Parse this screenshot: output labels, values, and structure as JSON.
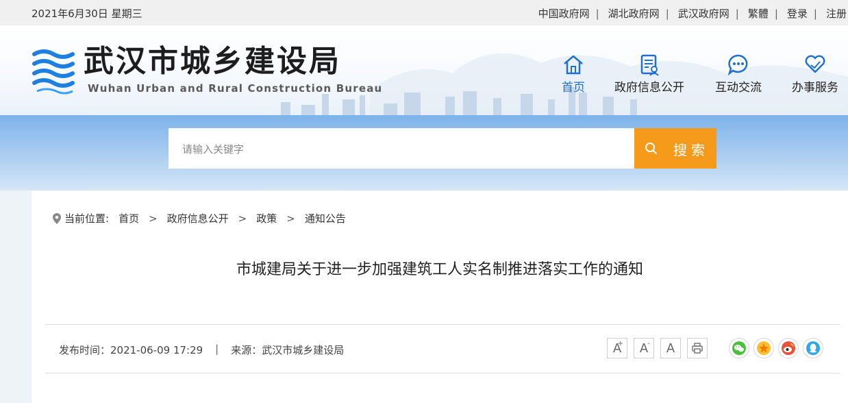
{
  "topbar": {
    "date": "2021年6月30日  星期三",
    "links": [
      "中国政府网",
      "湖北政府网",
      "武汉政府网",
      "繁體",
      "登录",
      "注册"
    ],
    "separator": "|"
  },
  "header": {
    "site_name_cn": "武汉市城乡建设局",
    "site_name_en": "Wuhan Urban and Rural Construction Bureau",
    "nav": [
      {
        "label": "首页",
        "icon": "home-icon"
      },
      {
        "label": "政府信息公开",
        "icon": "document-icon"
      },
      {
        "label": "互动交流",
        "icon": "chat-icon"
      },
      {
        "label": "办事服务",
        "icon": "heart-hand-icon"
      }
    ],
    "accent_color": "#1e6fd0"
  },
  "search": {
    "placeholder": "请输入关键字",
    "button_label": "搜索",
    "button_color": "#f59a1b"
  },
  "breadcrumb": {
    "prefix": "当前位置:",
    "items": [
      "首页",
      "政府信息公开",
      "政策",
      "通知公告"
    ],
    "separator": ">"
  },
  "article": {
    "title": "市城建局关于进一步加强建筑工人实名制推进落实工作的通知",
    "publish_time": "发布时间：2021-06-09 17:29",
    "meta_separator": "|",
    "source": "来源：武汉市城乡建设局"
  },
  "tools": {
    "font_large": "A",
    "font_small": "A",
    "font_default": "A"
  },
  "share": [
    "wechat-icon",
    "qzone-icon",
    "weibo-icon",
    "qq-icon"
  ]
}
